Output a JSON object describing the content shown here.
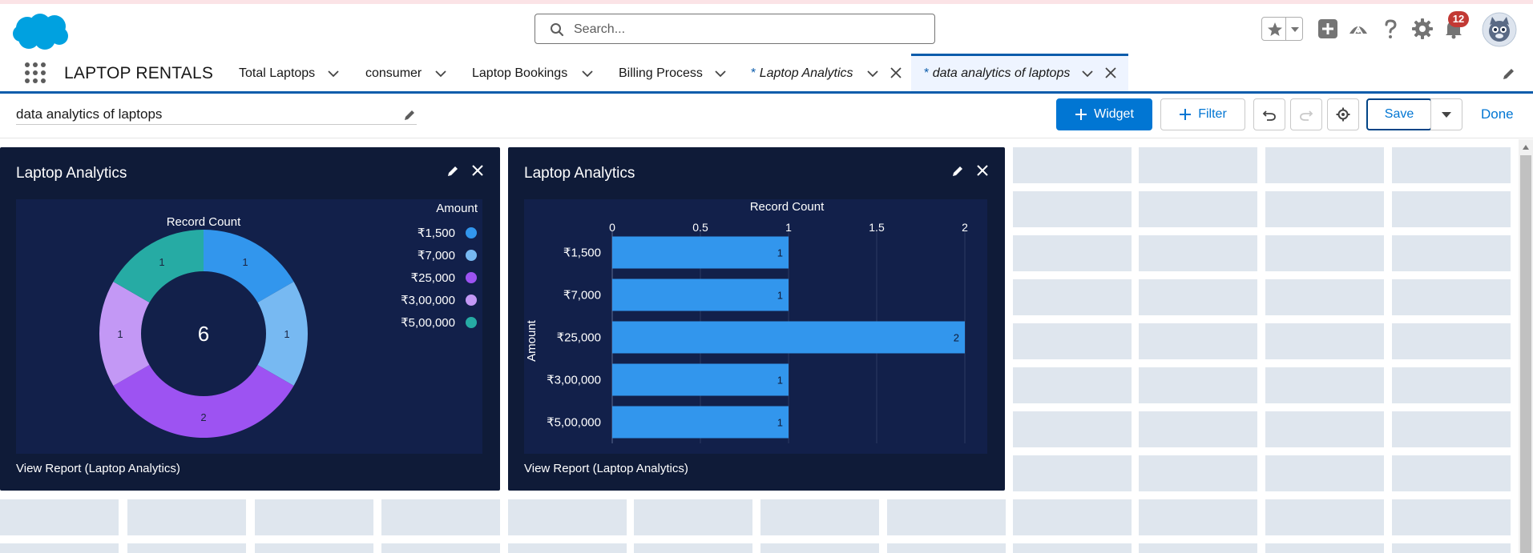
{
  "header": {
    "search_placeholder": "Search...",
    "notification_count": "12"
  },
  "nav": {
    "app_name": "LAPTOP RENTALS",
    "tabs": [
      {
        "label": "Total Laptops"
      },
      {
        "label": "consumer"
      },
      {
        "label": "Laptop Bookings"
      },
      {
        "label": "Billing Process"
      },
      {
        "label": "Laptop Analytics",
        "modified": "*"
      },
      {
        "label": "data analytics of laptops",
        "modified": "*"
      }
    ]
  },
  "toolbar": {
    "dashboard_title": "data analytics of laptops",
    "widget_label": "Widget",
    "filter_label": "Filter",
    "save_label": "Save",
    "done_label": "Done"
  },
  "widgets": [
    {
      "title": "Laptop Analytics",
      "link": "View Report (Laptop Analytics)"
    },
    {
      "title": "Laptop Analytics",
      "link": "View Report (Laptop Analytics)"
    }
  ],
  "colors": {
    "brand": "#0176d3",
    "widget_bg": "#0f1b38",
    "chart_bg": "#12204a"
  },
  "chart_data": [
    {
      "type": "pie",
      "variant": "donut",
      "title": "Record Count",
      "legend_title": "Amount",
      "legend_position": "top-right",
      "center_total": "6",
      "slices": [
        {
          "label": "₹1,500",
          "value": 1,
          "color": "#3296ed"
        },
        {
          "label": "₹7,000",
          "value": 1,
          "color": "#77b9f2"
        },
        {
          "label": "₹25,000",
          "value": 2,
          "color": "#9d53f2"
        },
        {
          "label": "₹3,00,000",
          "value": 1,
          "color": "#c398f5"
        },
        {
          "label": "₹5,00,000",
          "value": 1,
          "color": "#26aba4"
        }
      ]
    },
    {
      "type": "bar",
      "orientation": "horizontal",
      "title": "Record Count",
      "ylabel": "Amount",
      "categories": [
        "₹1,500",
        "₹7,000",
        "₹25,000",
        "₹3,00,000",
        "₹5,00,000"
      ],
      "values": [
        1,
        1,
        2,
        1,
        1
      ],
      "xlim": [
        0,
        2
      ],
      "ticks": [
        "0",
        "0.5",
        "1",
        "1.5",
        "2"
      ],
      "grid": true,
      "bar_color": "#3296ed"
    }
  ]
}
